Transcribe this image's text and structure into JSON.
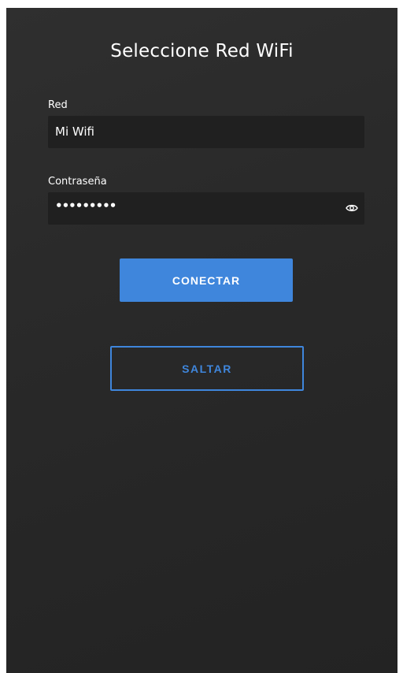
{
  "screen": {
    "title": "Seleccione Red WiFi"
  },
  "network": {
    "label": "Red",
    "value": "Mi Wifi"
  },
  "password": {
    "label": "Contraseña",
    "masked_value": "•••••••••",
    "toggle_icon": "eye-icon"
  },
  "actions": {
    "connect_label": "CONECTAR",
    "skip_label": "SALTAR"
  },
  "colors": {
    "accent": "#3f86dc",
    "background": "#2a2a2a",
    "field_background": "#202020",
    "text": "#ffffff"
  }
}
